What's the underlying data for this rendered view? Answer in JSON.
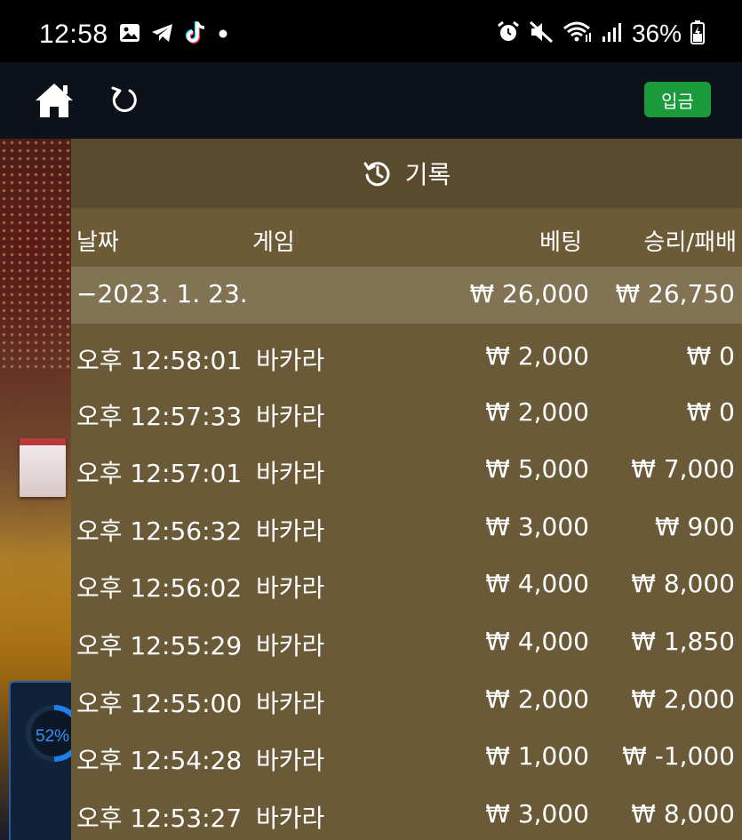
{
  "status_bar": {
    "time": "12:58",
    "battery": "36%",
    "icons": [
      "gallery-icon",
      "telegram-icon",
      "tiktok-icon",
      "dot-icon",
      "alarm-icon",
      "mute-icon",
      "wifi-icon",
      "signal-icon",
      "battery-icon"
    ]
  },
  "app_bar": {
    "deposit_label": "입금",
    "icons": [
      "home-icon",
      "refresh-icon"
    ]
  },
  "game_peek": {
    "percent": "52%",
    "percent_value": 52,
    "accent": "#3a8ef0"
  },
  "history": {
    "title": "기록",
    "columns": {
      "date": "날짜",
      "game": "게임",
      "bet": "베팅",
      "result": "승리/패배"
    },
    "summary": {
      "date": "−2023. 1. 23.",
      "bet": "₩ 26,000",
      "result": "₩ 26,750"
    },
    "rows": [
      {
        "time": "오후 12:58:01",
        "game": "바카라",
        "bet": "₩ 2,000",
        "result": "₩ 0"
      },
      {
        "time": "오후 12:57:33",
        "game": "바카라",
        "bet": "₩ 2,000",
        "result": "₩ 0"
      },
      {
        "time": "오후 12:57:01",
        "game": "바카라",
        "bet": "₩ 5,000",
        "result": "₩ 7,000"
      },
      {
        "time": "오후 12:56:32",
        "game": "바카라",
        "bet": "₩ 3,000",
        "result": "₩ 900"
      },
      {
        "time": "오후 12:56:02",
        "game": "바카라",
        "bet": "₩ 4,000",
        "result": "₩ 8,000"
      },
      {
        "time": "오후 12:55:29",
        "game": "바카라",
        "bet": "₩ 4,000",
        "result": "₩ 1,850"
      },
      {
        "time": "오후 12:55:00",
        "game": "바카라",
        "bet": "₩ 2,000",
        "result": "₩ 2,000"
      },
      {
        "time": "오후 12:54:28",
        "game": "바카라",
        "bet": "₩ 1,000",
        "result": "₩ -1,000"
      },
      {
        "time": "오후 12:53:27",
        "game": "바카라",
        "bet": "₩ 3,000",
        "result": "₩ 8,000"
      }
    ]
  },
  "colors": {
    "status_bar_bg": "#000000",
    "app_bar_bg": "#0d111a",
    "deposit_green": "#1a9a3a",
    "panel_bg": "#6b5a38",
    "header_bg": "#5a4a2e",
    "summary_bg": "#837355"
  }
}
